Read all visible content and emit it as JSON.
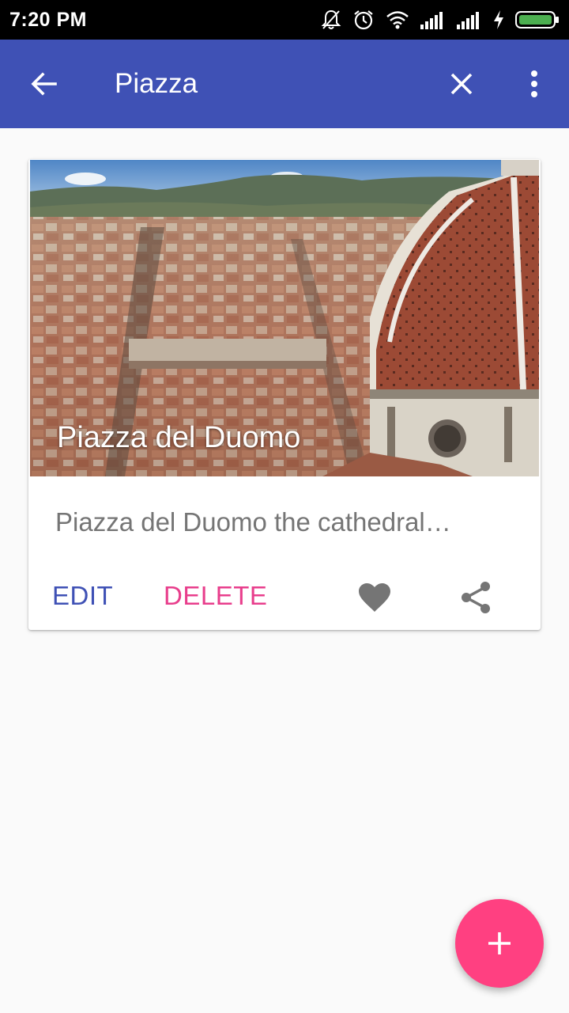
{
  "status_bar": {
    "time": "7:20 PM",
    "icons": [
      "notifications-off-icon",
      "alarm-icon",
      "wifi-icon",
      "signal-icon",
      "signal-icon",
      "charging-icon",
      "battery-icon"
    ],
    "battery_color": "#4caf50"
  },
  "app_bar": {
    "title": "Piazza",
    "back_icon": "arrow-back-icon",
    "close_icon": "close-icon",
    "more_icon": "more-vert-icon",
    "color": "#3f51b5"
  },
  "card": {
    "image_title": "Piazza del Duomo",
    "description": "Piazza del Duomo the cathedral…",
    "actions": {
      "edit_label": "EDIT",
      "delete_label": "DELETE",
      "favorite_icon": "heart-icon",
      "share_icon": "share-icon"
    },
    "colors": {
      "edit": "#3f51b5",
      "delete": "#e83e8c"
    }
  },
  "fab": {
    "icon": "plus-icon",
    "color": "#ff4081"
  }
}
